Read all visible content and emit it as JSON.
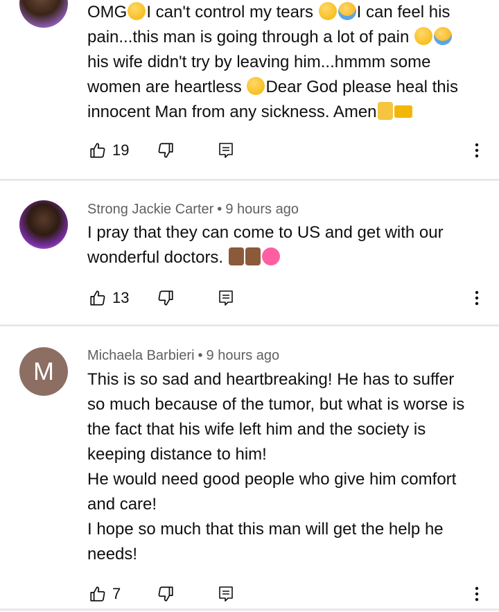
{
  "comments": [
    {
      "author": "",
      "time": "",
      "lines": [
        "OMG{sad}I can't control my tears {pensive}{cry}I can feel his",
        "pain...this man is going through a lot of pain {pensive}{cry}",
        "his wife didn't try by leaving him...hmmm some",
        "women are heartless {sad}Dear God please heal this",
        "innocent Man from any sickness. Amen{pray}{crown}"
      ],
      "text_plain": [
        "OMG",
        "I can't control my tears ",
        "I can feel his",
        "pain...this man is going through a lot of pain ",
        "his wife didn't try by leaving him...hmmm some",
        "women are heartless ",
        "Dear God please heal this",
        "innocent Man from any sickness. Amen"
      ],
      "likes": "19"
    },
    {
      "author": "Strong Jackie Carter",
      "separator": "•",
      "time": "9 hours ago",
      "text_plain": [
        "I pray that they can come to US and get with our",
        "wonderful doctors. "
      ],
      "likes": "13"
    },
    {
      "author": "Michaela Barbieri",
      "separator": "•",
      "time": "9 hours ago",
      "avatar_letter": "M",
      "text_plain": [
        "This is so sad and heartbreaking! He has to suffer",
        "so much because of the tumor, but what is worse is",
        "the fact that his wife left him and the society is",
        "keeping distance to him!",
        "He would need good people who give him comfort",
        "and care!",
        "I hope so much that this man will get the help he",
        "needs!"
      ],
      "likes": "7"
    }
  ],
  "icons": {
    "like": "thumbs-up-icon",
    "dislike": "thumbs-down-icon",
    "reply": "reply-icon",
    "more": "more-vertical-icon"
  },
  "colors": {
    "meta_text": "#606060",
    "divider": "#e8e8e8",
    "letter_avatar_bg": "#8d6e63"
  }
}
